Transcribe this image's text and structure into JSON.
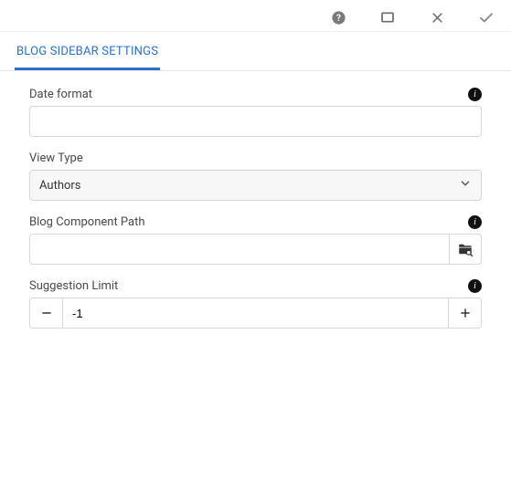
{
  "toolbar": {
    "help_icon": "help",
    "fullscreen_icon": "fullscreen",
    "close_icon": "close",
    "done_icon": "check"
  },
  "tabs": {
    "active": "BLOG SIDEBAR SETTINGS"
  },
  "fields": {
    "date_format": {
      "label": "Date format",
      "value": ""
    },
    "view_type": {
      "label": "View Type",
      "selected": "Authors"
    },
    "blog_component_path": {
      "label": "Blog Component Path",
      "value": ""
    },
    "suggestion_limit": {
      "label": "Suggestion Limit",
      "value": "-1"
    }
  }
}
